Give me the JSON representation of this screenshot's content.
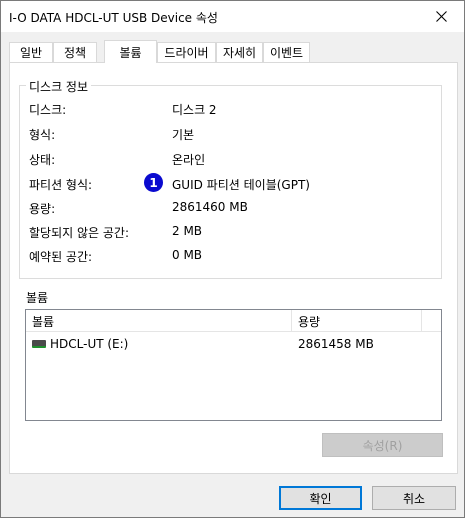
{
  "window": {
    "title": "I-O DATA HDCL-UT USB Device 속성"
  },
  "tabs": [
    {
      "label": "일반"
    },
    {
      "label": "정책"
    },
    {
      "label": "볼륨"
    },
    {
      "label": "드라이버"
    },
    {
      "label": "자세히"
    },
    {
      "label": "이벤트"
    }
  ],
  "active_tab": "볼륨",
  "disk_info": {
    "title": "디스크 정보",
    "rows": [
      {
        "label": "디스크:",
        "value": "디스크 2"
      },
      {
        "label": "형식:",
        "value": "기본"
      },
      {
        "label": "상태:",
        "value": "온라인"
      },
      {
        "label": "파티션 형식:",
        "value": "GUID 파티션 테이블(GPT)"
      },
      {
        "label": "용량:",
        "value": "2861460 MB"
      },
      {
        "label": "할당되지 않은 공간:",
        "value": "2 MB"
      },
      {
        "label": "예약된 공간:",
        "value": "0 MB"
      }
    ],
    "marker": "1"
  },
  "volumes": {
    "title": "볼륨",
    "columns": [
      "볼륨",
      "용량"
    ],
    "rows": [
      {
        "name": "HDCL-UT (E:)",
        "capacity": "2861458 MB"
      }
    ]
  },
  "buttons": {
    "properties": "속성(R)",
    "ok": "확인",
    "cancel": "취소"
  }
}
